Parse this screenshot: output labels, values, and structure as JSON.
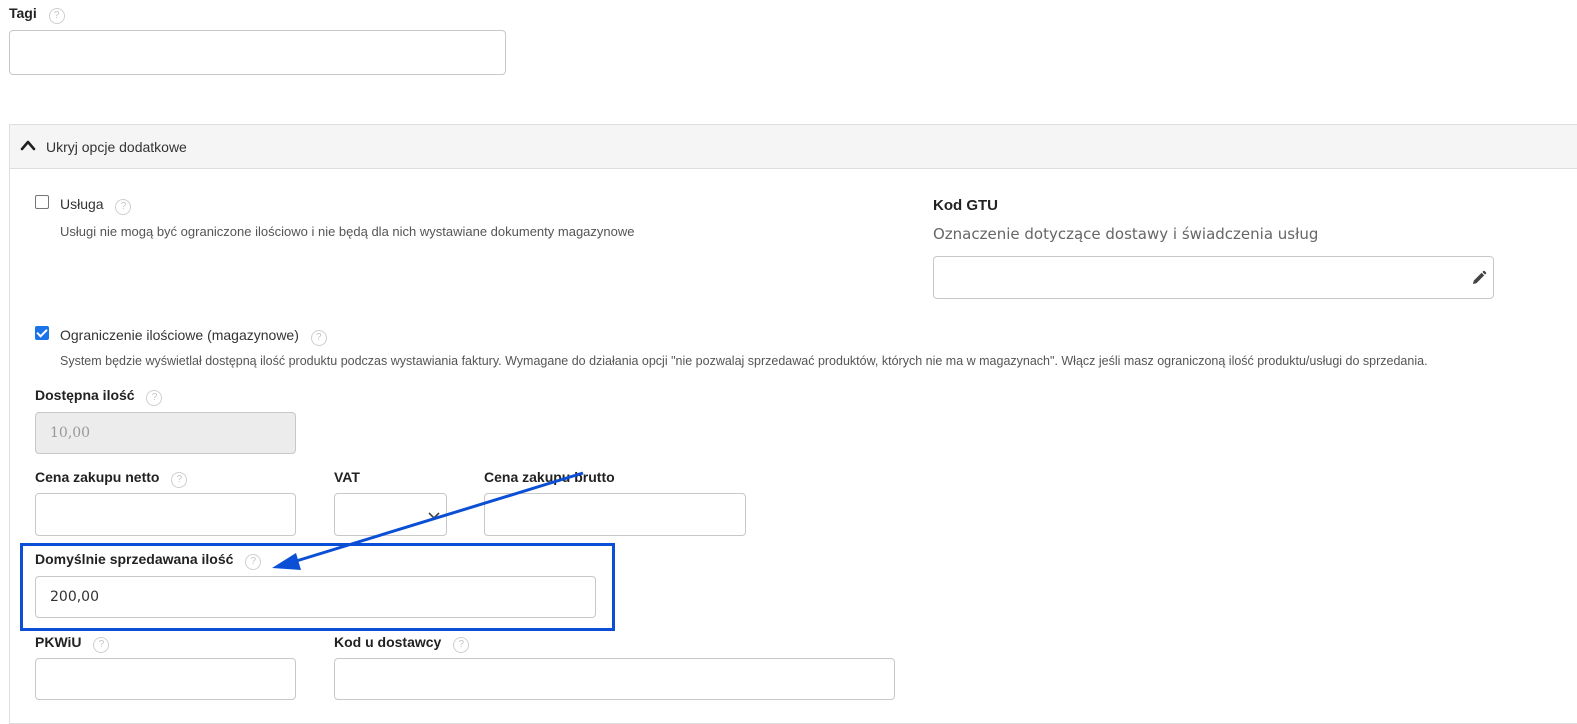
{
  "tags": {
    "label": "Tagi",
    "help": "?"
  },
  "section": {
    "toggle_label": "Ukryj opcje dodatkowe"
  },
  "service": {
    "label": "Usługa",
    "checked": false,
    "description": "Usługi nie mogą być ograniczone ilościowo i nie będą dla nich wystawiane dokumenty magazynowe"
  },
  "gtu": {
    "title": "Kod GTU",
    "subtitle": "Oznaczenie dotyczące dostawy i świadczenia usług",
    "value": ""
  },
  "stock_limit": {
    "label": "Ograniczenie ilościowe (magazynowe)",
    "checked": true,
    "description": "System będzie wyświetlał dostępną ilość produktu podczas wystawiania faktury. Wymagane do działania opcji \"nie pozwalaj sprzedawać produktów, których nie ma w magazynach\". Włącz jeśli masz ograniczoną ilość produktu/usługi do sprzedania."
  },
  "available_qty": {
    "label": "Dostępna ilość",
    "value": "10,00"
  },
  "purchase_net": {
    "label": "Cena zakupu netto",
    "value": ""
  },
  "vat": {
    "label": "VAT",
    "value": ""
  },
  "purchase_gross": {
    "label": "Cena zakupu brutto",
    "value": ""
  },
  "default_qty": {
    "label": "Domyślnie sprzedawana ilość",
    "value": "200,00"
  },
  "pkwiu": {
    "label": "PKWiU",
    "value": ""
  },
  "supplier_code": {
    "label": "Kod u dostawcy",
    "value": ""
  },
  "colors": {
    "annotation": "#0b4fd6",
    "checkbox": "#1a73e8"
  }
}
